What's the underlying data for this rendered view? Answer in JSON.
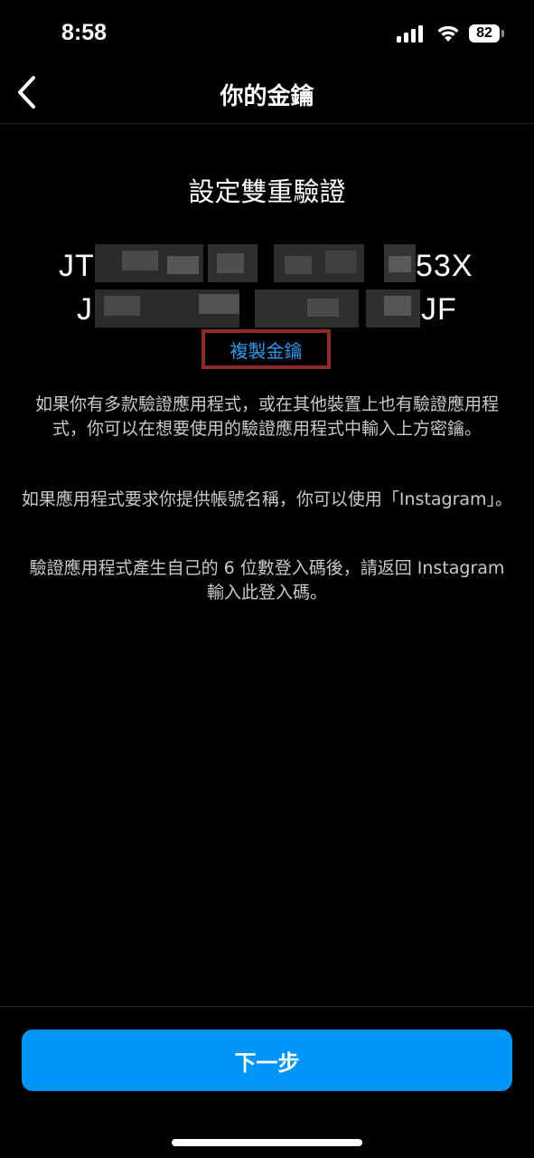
{
  "status_bar": {
    "time": "8:58",
    "battery_level": "82",
    "icons": [
      "signal-icon",
      "wifi-icon",
      "battery-icon"
    ]
  },
  "nav": {
    "back_icon": "chevron-left-icon",
    "title": "你的金鑰"
  },
  "heading": "設定雙重驗證",
  "secret_key": {
    "line1_start": "JT",
    "line1_end": "53X",
    "line2_start": "J",
    "line2_end": "JF",
    "redacted": true
  },
  "copy_key_label": "複製金鑰",
  "paragraphs": [
    "如果你有多款驗證應用程式，或在其他裝置上也有驗證應用程式，你可以在想要使用的驗證應用程式中輸入上方密鑰。",
    "如果應用程式要求你提供帳號名稱，你可以使用「Instagram」。",
    "驗證應用程式產生自己的 6 位數登入碼後，請返回 Instagram 輸入此登入碼。"
  ],
  "next_button_label": "下一步",
  "colors": {
    "background": "#000000",
    "accent": "#0095f6",
    "link": "#2d9bf0",
    "highlight_border": "#8c2a27"
  }
}
